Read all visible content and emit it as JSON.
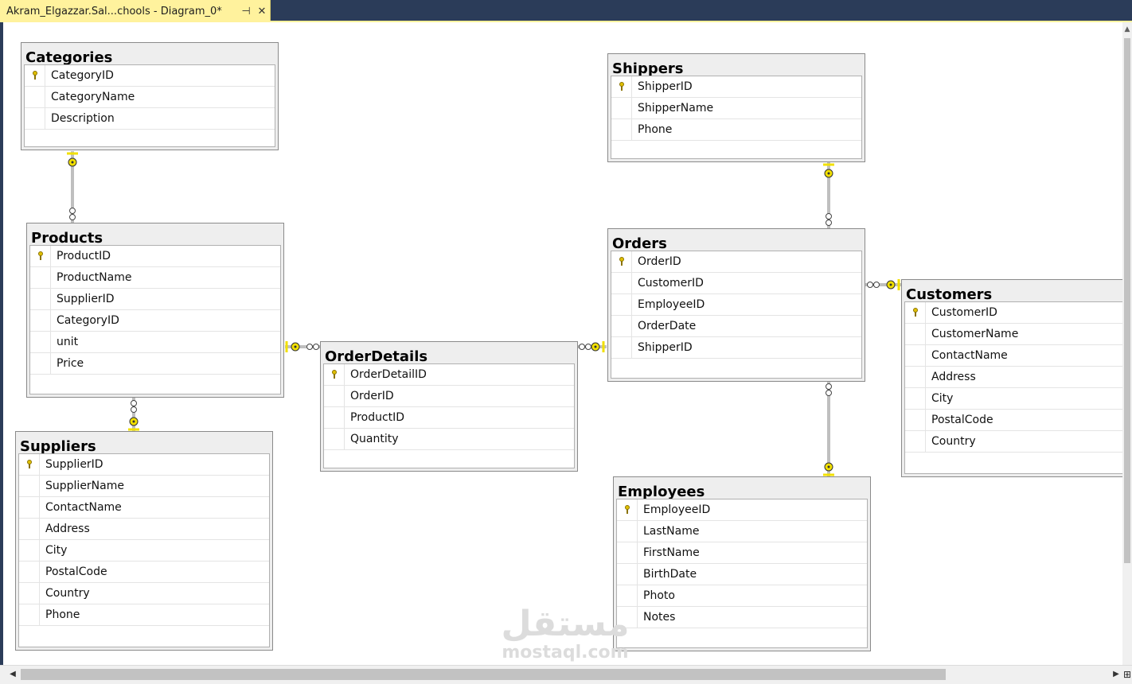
{
  "tab": {
    "title": "Akram_Elgazzar.Sal...chools - Diagram_0*",
    "pin_glyph": "⊣",
    "close_glyph": "✕"
  },
  "tables": {
    "categories": {
      "name": "Categories",
      "columns": [
        {
          "name": "CategoryID",
          "pk": true
        },
        {
          "name": "CategoryName",
          "pk": false
        },
        {
          "name": "Description",
          "pk": false
        }
      ]
    },
    "products": {
      "name": "Products",
      "columns": [
        {
          "name": "ProductID",
          "pk": true
        },
        {
          "name": "ProductName",
          "pk": false
        },
        {
          "name": "SupplierID",
          "pk": false
        },
        {
          "name": "CategoryID",
          "pk": false
        },
        {
          "name": "unit",
          "pk": false
        },
        {
          "name": "Price",
          "pk": false
        }
      ]
    },
    "suppliers": {
      "name": "Suppliers",
      "columns": [
        {
          "name": "SupplierID",
          "pk": true
        },
        {
          "name": "SupplierName",
          "pk": false
        },
        {
          "name": "ContactName",
          "pk": false
        },
        {
          "name": "Address",
          "pk": false
        },
        {
          "name": "City",
          "pk": false
        },
        {
          "name": "PostalCode",
          "pk": false
        },
        {
          "name": "Country",
          "pk": false
        },
        {
          "name": "Phone",
          "pk": false
        }
      ]
    },
    "orderdetails": {
      "name": "OrderDetails",
      "columns": [
        {
          "name": "OrderDetailID",
          "pk": true
        },
        {
          "name": "OrderID",
          "pk": false
        },
        {
          "name": "ProductID",
          "pk": false
        },
        {
          "name": "Quantity",
          "pk": false
        }
      ]
    },
    "shippers": {
      "name": "Shippers",
      "columns": [
        {
          "name": "ShipperID",
          "pk": true
        },
        {
          "name": "ShipperName",
          "pk": false
        },
        {
          "name": "Phone",
          "pk": false
        }
      ]
    },
    "orders": {
      "name": "Orders",
      "columns": [
        {
          "name": "OrderID",
          "pk": true
        },
        {
          "name": "CustomerID",
          "pk": false
        },
        {
          "name": "EmployeeID",
          "pk": false
        },
        {
          "name": "OrderDate",
          "pk": false
        },
        {
          "name": "ShipperID",
          "pk": false
        }
      ]
    },
    "customers": {
      "name": "Customers",
      "columns": [
        {
          "name": "CustomerID",
          "pk": true
        },
        {
          "name": "CustomerName",
          "pk": false
        },
        {
          "name": "ContactName",
          "pk": false
        },
        {
          "name": "Address",
          "pk": false
        },
        {
          "name": "City",
          "pk": false
        },
        {
          "name": "PostalCode",
          "pk": false
        },
        {
          "name": "Country",
          "pk": false
        }
      ]
    },
    "employees": {
      "name": "Employees",
      "columns": [
        {
          "name": "EmployeeID",
          "pk": true
        },
        {
          "name": "LastName",
          "pk": false
        },
        {
          "name": "FirstName",
          "pk": false
        },
        {
          "name": "BirthDate",
          "pk": false
        },
        {
          "name": "Photo",
          "pk": false
        },
        {
          "name": "Notes",
          "pk": false
        }
      ]
    }
  },
  "watermark": {
    "arabic": "مستقل",
    "latin": "mostaql.com"
  },
  "scrollbar": {
    "left_glyph": "◀",
    "right_glyph": "▶",
    "up_glyph": "▲",
    "corner_glyph": "⊞"
  }
}
